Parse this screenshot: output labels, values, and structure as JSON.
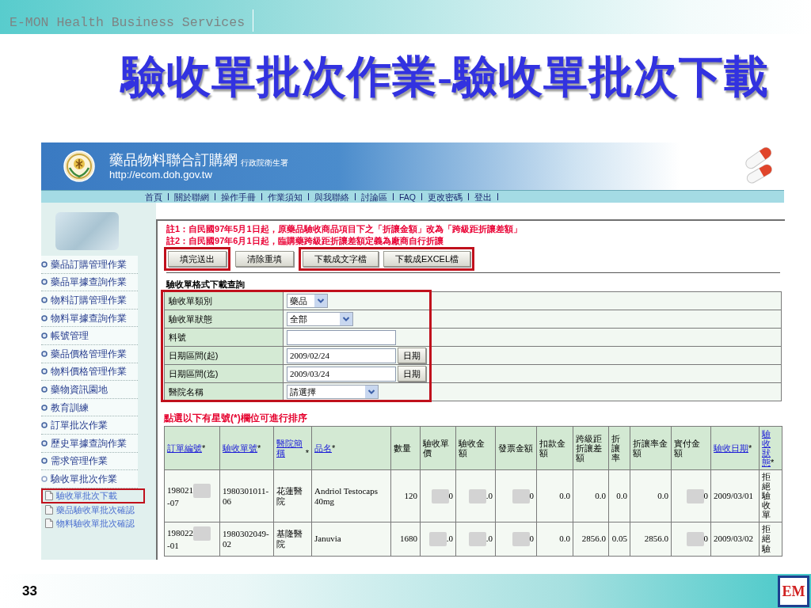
{
  "slide_header": {
    "brand": "E-MON Health Business Services"
  },
  "title": "驗收單批次作業-驗收單批次下載",
  "site_header": {
    "site_name": "藥品物料聯合訂購網",
    "agency": "行政院衛生署",
    "url": "http://ecom.doh.gov.tw"
  },
  "nav_links": [
    "首頁",
    "關於聯網",
    "操作手冊",
    "作業須知",
    "與我聯絡",
    "討論區",
    "FAQ",
    "更改密碼",
    "登出"
  ],
  "sidebar": {
    "items": [
      {
        "label": "藥品訂購管理作業",
        "expanded": false
      },
      {
        "label": "藥品單據查詢作業",
        "expanded": false
      },
      {
        "label": "物料訂購管理作業",
        "expanded": false
      },
      {
        "label": "物料單據查詢作業",
        "expanded": false
      },
      {
        "label": "帳號管理",
        "expanded": false
      },
      {
        "label": "藥品價格管理作業",
        "expanded": false
      },
      {
        "label": "物料價格管理作業",
        "expanded": false
      },
      {
        "label": "藥物資訊園地",
        "expanded": false
      },
      {
        "label": "教育訓練",
        "expanded": false
      },
      {
        "label": "訂單批次作業",
        "expanded": false
      },
      {
        "label": "歷史單據查詢作業",
        "expanded": false
      },
      {
        "label": "需求管理作業",
        "expanded": false
      },
      {
        "label": "驗收單批次作業",
        "expanded": true,
        "children": [
          {
            "label": "驗收單批次下載",
            "highlighted": true
          },
          {
            "label": "藥品驗收單批次確認",
            "highlighted": false
          },
          {
            "label": "物料驗收單批次確認",
            "highlighted": false
          }
        ]
      }
    ]
  },
  "notes": [
    "註1：自民國97年5月1日起，原藥品驗收商品項目下之「折讓金額」改為「跨級距折讓差額」",
    "註2：自民國97年6月1日起，臨購藥跨級距折讓差額定義為廠商自行折讓"
  ],
  "button_groups": [
    {
      "highlighted": true,
      "buttons": [
        "填完送出"
      ]
    },
    {
      "highlighted": false,
      "buttons": [
        "清除重填"
      ]
    },
    {
      "highlighted": true,
      "buttons": [
        "下載成文字檔",
        "下載成EXCEL檔"
      ]
    }
  ],
  "query_form": {
    "title": "驗收單格式下載查詢",
    "highlighted": true,
    "rows": [
      {
        "label": "驗收單類別",
        "kind": "select",
        "value": "藥品"
      },
      {
        "label": "驗收單狀態",
        "kind": "select",
        "value": "全部"
      },
      {
        "label": "料號",
        "kind": "text"
      },
      {
        "label": "日期區間(起)",
        "kind": "date",
        "value": "2009/02/24",
        "button": "日期"
      },
      {
        "label": "日期區間(迄)",
        "kind": "date",
        "value": "2009/03/24",
        "button": "日期"
      },
      {
        "label": "醫院名稱",
        "kind": "select",
        "value": "請選擇"
      }
    ]
  },
  "results": {
    "hint": "點選以下有星號(*)欄位可進行排序",
    "columns": [
      {
        "label": "訂單編號",
        "sort_mark": "*",
        "link": true,
        "kind": "text"
      },
      {
        "label": "驗收單號",
        "sort_mark": "*",
        "link": true,
        "kind": "text"
      },
      {
        "label": "醫院簡稱",
        "sort_mark": "*",
        "link": true,
        "kind": "text"
      },
      {
        "label": "品名",
        "sort_mark": "*",
        "link": true,
        "kind": "text"
      },
      {
        "label": "數量",
        "link": false,
        "kind": "number"
      },
      {
        "label": "驗收單價",
        "link": false,
        "kind": "number"
      },
      {
        "label": "驗收金額",
        "link": false,
        "kind": "number"
      },
      {
        "label": "發票金額",
        "link": false,
        "kind": "number"
      },
      {
        "label": "扣款金額",
        "link": false,
        "kind": "number"
      },
      {
        "label": "跨級距折讓差額",
        "link": false,
        "kind": "number"
      },
      {
        "label": "折讓率",
        "link": false,
        "kind": "number"
      },
      {
        "label": "折讓率金額",
        "link": false,
        "kind": "number"
      },
      {
        "label": "實付金額",
        "link": false,
        "kind": "number"
      },
      {
        "label": "驗收日期",
        "sort_mark": "*",
        "link": true,
        "kind": "text"
      },
      {
        "label": "驗收狀態",
        "sort_mark": "*",
        "link": true,
        "kind": "vertical"
      }
    ],
    "rows": [
      {
        "cells": [
          {
            "before": "198021",
            "redacted": true,
            "text": "-07"
          },
          {
            "text": "1980301011-06"
          },
          {
            "text": "花蓮醫院"
          },
          {
            "text": "Andriol Testocaps 40mg"
          },
          {
            "text": "120"
          },
          {
            "redacted": true,
            "text": "0"
          },
          {
            "redacted": true,
            "text": ".0"
          },
          {
            "redacted": true,
            "text": "0"
          },
          {
            "text": "0.0"
          },
          {
            "text": "0.0"
          },
          {
            "text": "0.0"
          },
          {
            "text": "0.0"
          },
          {
            "redacted": true,
            "text": "0"
          },
          {
            "text": "2009/03/01"
          },
          {
            "text": "拒絕驗收單"
          }
        ]
      },
      {
        "cells": [
          {
            "before": "198022",
            "redacted": true,
            "text": "-01"
          },
          {
            "text": "1980302049-02"
          },
          {
            "text": "基隆醫院"
          },
          {
            "text": "Januvia"
          },
          {
            "text": "1680"
          },
          {
            "redacted": true,
            "text": ".0"
          },
          {
            "redacted": true,
            "text": ".0"
          },
          {
            "redacted": true,
            "text": "0"
          },
          {
            "text": "0.0"
          },
          {
            "text": "2856.0"
          },
          {
            "text": "0.05"
          },
          {
            "text": "2856.0"
          },
          {
            "redacted": true,
            "text": "0"
          },
          {
            "text": "2009/03/02"
          },
          {
            "text": "拒絕驗"
          }
        ]
      }
    ]
  },
  "footer": {
    "page_number": "33",
    "logo_text": "EM"
  }
}
